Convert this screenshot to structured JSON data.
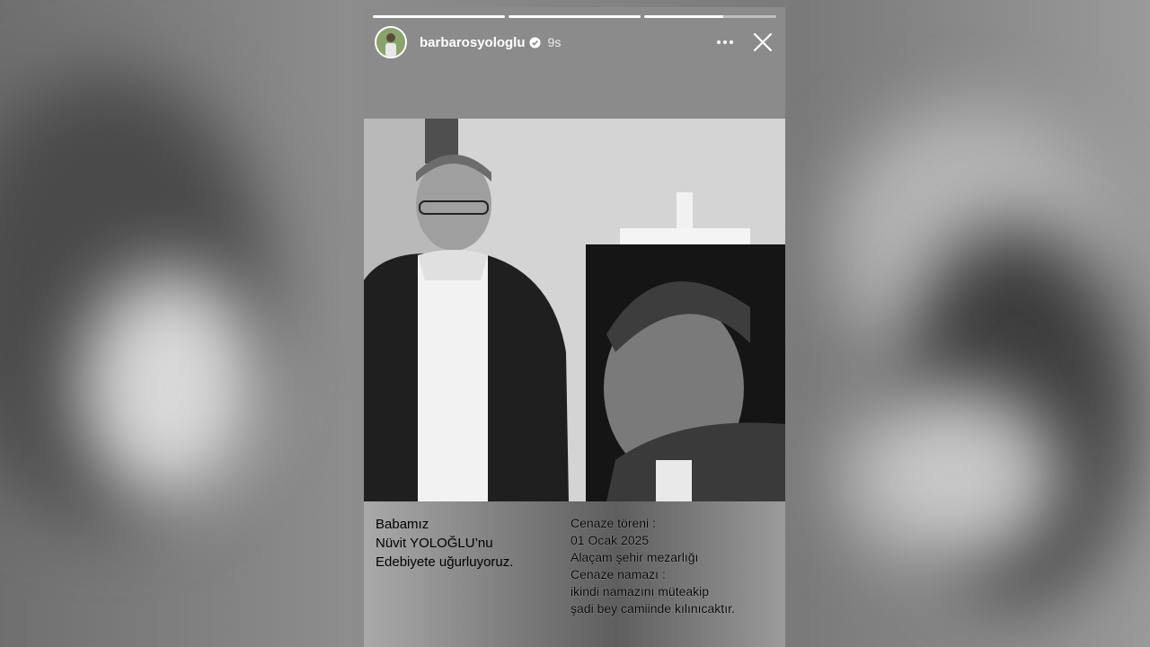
{
  "story": {
    "progress": [
      1.0,
      1.0,
      0.6,
      0.0
    ],
    "username": "barbarosyologlu",
    "time": "9s",
    "colors": {
      "text": "#ffffff",
      "verified": "#ffffff"
    }
  },
  "icons": {
    "verified": "verified-badge-icon",
    "more": "more-options-icon",
    "close": "close-icon"
  },
  "caption": {
    "left": [
      "Babamız",
      "Nüvit YOLOĞLU’nu",
      "Edebiyete uğurluyoruz."
    ],
    "right": [
      "Cenaze töreni :",
      "01 Ocak 2025",
      "Alaçam şehir mezarlığı",
      "Cenaze namazı :",
      "ikindi namazını müteakip",
      "şadi bey camiinde kılınıcaktır."
    ]
  }
}
